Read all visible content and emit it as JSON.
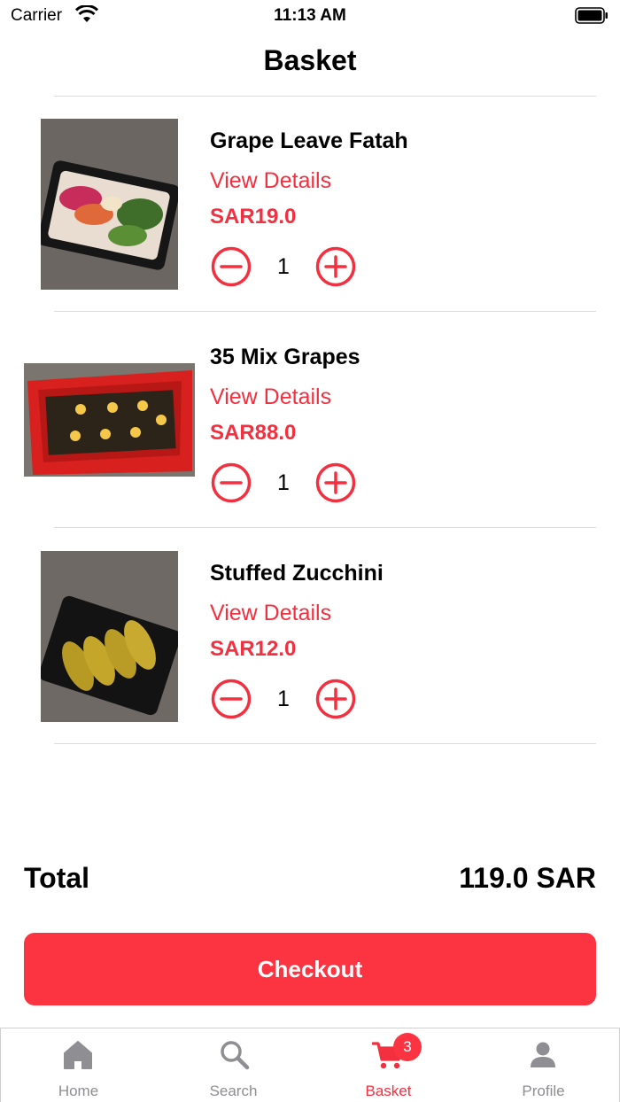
{
  "status_bar": {
    "carrier": "Carrier",
    "time": "11:13 AM",
    "icons": [
      "wifi-icon",
      "battery-icon"
    ]
  },
  "header": {
    "title": "Basket"
  },
  "items": [
    {
      "name": "Grape Leave Fatah",
      "details_label": "View Details",
      "price": "SAR19.0",
      "quantity": "1",
      "image": "grape-leave-fatah-photo"
    },
    {
      "name": "35 Mix Grapes",
      "details_label": "View Details",
      "price": "SAR88.0",
      "quantity": "1",
      "image": "mix-grapes-box-photo"
    },
    {
      "name": "Stuffed Zucchini",
      "details_label": "View Details",
      "price": "SAR12.0",
      "quantity": "1",
      "image": "stuffed-zucchini-photo"
    }
  ],
  "summary": {
    "total_label": "Total",
    "total_value": "119.0 SAR"
  },
  "checkout": {
    "label": "Checkout"
  },
  "tab_bar": {
    "tabs": [
      {
        "label": "Home",
        "icon": "home-icon"
      },
      {
        "label": "Search",
        "icon": "search-icon"
      },
      {
        "label": "Basket",
        "icon": "cart-icon",
        "badge": "3"
      },
      {
        "label": "Profile",
        "icon": "profile-icon"
      }
    ],
    "active": "Basket"
  },
  "colors": {
    "accent": "#f2303f",
    "button": "#fc3441",
    "inactive_tab": "#8e8e93"
  }
}
